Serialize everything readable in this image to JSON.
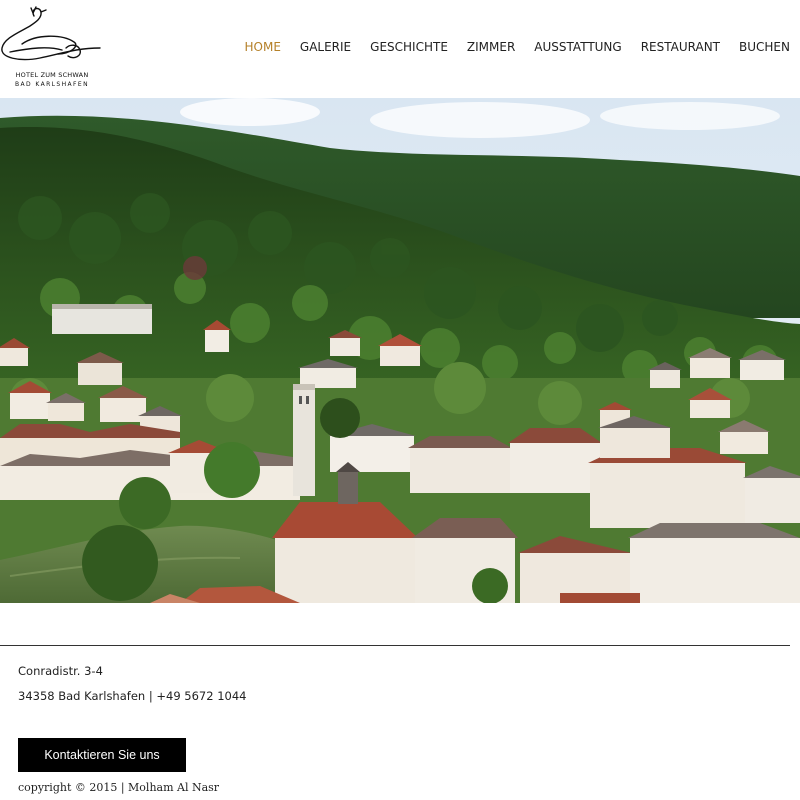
{
  "logo": {
    "icon": "swan-icon",
    "line1": "HOTEL ZUM SCHWAN",
    "line2": "BAD KARLSHAFEN"
  },
  "nav": {
    "items": [
      {
        "label": "HOME",
        "active": true
      },
      {
        "label": "GALERIE",
        "active": false
      },
      {
        "label": "GESCHICHTE",
        "active": false
      },
      {
        "label": "ZIMMER",
        "active": false
      },
      {
        "label": "AUSSTATTUNG",
        "active": false
      },
      {
        "label": "RESTAURANT",
        "active": false
      },
      {
        "label": "BUCHEN",
        "active": false
      }
    ]
  },
  "hero": {
    "scene": "aerial-town-photo"
  },
  "footer": {
    "address_line1": "Conradistr. 3-4",
    "address_line2": "34358 Bad Karlshafen | +49 5672 1044",
    "contact_button": "Kontaktieren Sie uns",
    "copyright": "copyright © 2015 | Molham Al Nasr"
  },
  "colors": {
    "active_nav": "#b5812a",
    "button_bg": "#000000",
    "button_text": "#ffffff",
    "forest_dark": "#1e3f16",
    "forest_mid": "#3e6b26",
    "roof": "#9a4a34",
    "river": "#5f7a45"
  }
}
